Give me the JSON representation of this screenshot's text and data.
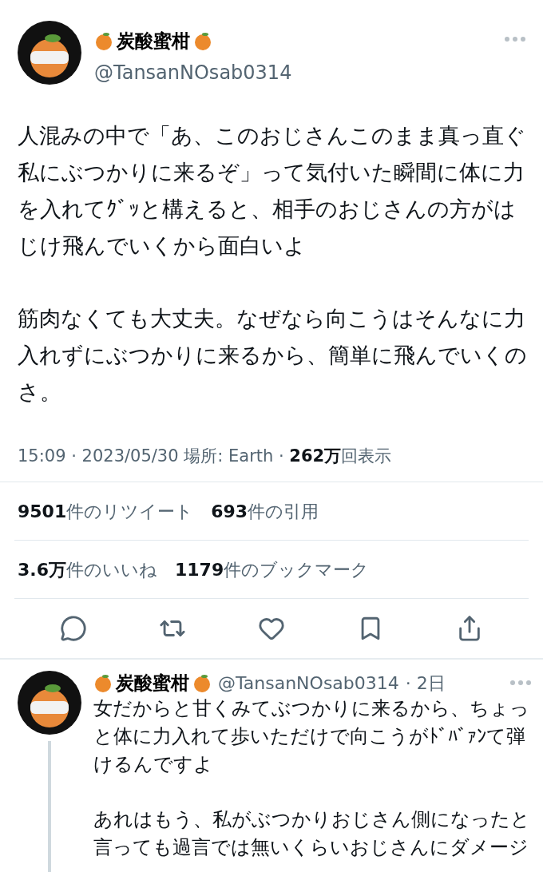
{
  "tweet": {
    "name": "炭酸蜜柑",
    "handle": "@TansanNOsab0314",
    "paragraphs": [
      "人混みの中で「あ、このおじさんこのまま真っ直ぐ私にぶつかりに来るぞ」って気付いた瞬間に体に力を入れてｸﾞｯと構えると、相手のおじさんの方がはじけ飛んでいくから面白いよ",
      "筋肉なくても大丈夫。なぜなら向こうはそんなに力入れずにぶつかりに来るから、簡単に飛んでいくのさ。"
    ],
    "meta": "15:09 · 2023/05/30 場所: Earth · ",
    "views": {
      "count": "262万",
      "label": "回表示"
    },
    "stats": [
      [
        {
          "count": "9501",
          "label": "件のリツイート"
        },
        {
          "count": "693",
          "label": "件の引用"
        }
      ],
      [
        {
          "count": "3.6万",
          "label": "件のいいね"
        },
        {
          "count": "1179",
          "label": "件のブックマーク"
        }
      ]
    ],
    "actions": [
      {
        "kind": "reply"
      },
      {
        "kind": "retweet"
      },
      {
        "kind": "like"
      },
      {
        "kind": "bookmark"
      },
      {
        "kind": "share"
      }
    ]
  },
  "reply": {
    "name": "炭酸蜜柑",
    "handle": "@TansanNOsab0314",
    "time": "· 2日",
    "paragraphs": [
      "女だからと甘くみてぶつかりに来るから、ちょっと体に力入れて歩いただけで向こうがﾄﾞﾊﾞｧﾝて弾けるんですよ",
      "あれはもう、私がぶつかりおじさん側になったと言っても過言では無いくらいおじさんにダメージ"
    ]
  }
}
